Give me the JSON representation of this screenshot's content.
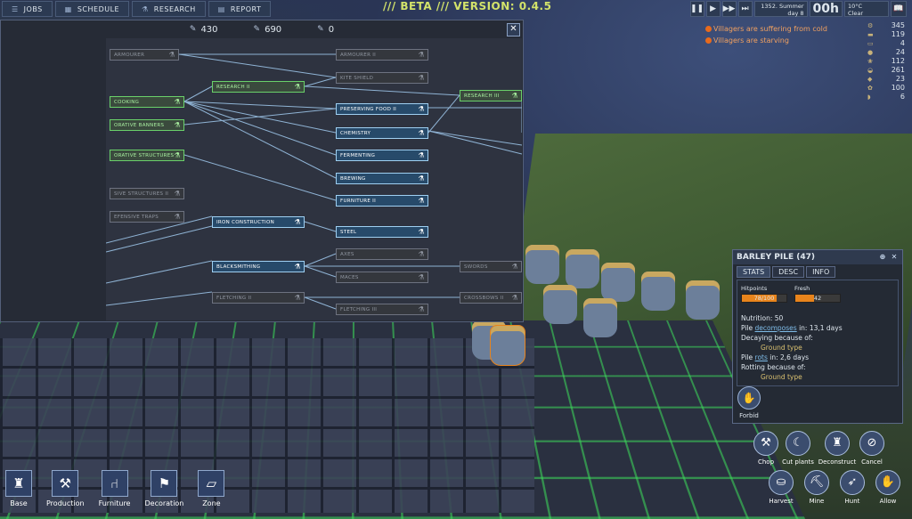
{
  "top_menu": [
    {
      "label": "JOBS",
      "icon": "list-icon"
    },
    {
      "label": "SCHEDULE",
      "icon": "calendar-icon"
    },
    {
      "label": "RESEARCH",
      "icon": "flask-icon"
    },
    {
      "label": "REPORT",
      "icon": "chart-icon"
    }
  ],
  "version_text": "/// BETA /// VERSION: 0.4.5",
  "time": {
    "date_line1": "1352. Summer",
    "date_line2": "day 8",
    "clock": "00h",
    "temperature": "10°C",
    "weather": "Clear"
  },
  "alerts": [
    "Villagers are suffering from cold",
    "Villagers are starving"
  ],
  "resources": [
    {
      "icon": "gear-icon",
      "value": "345"
    },
    {
      "icon": "log-icon",
      "value": "119"
    },
    {
      "icon": "plank-icon",
      "value": "4"
    },
    {
      "icon": "stone-icon",
      "value": "24"
    },
    {
      "icon": "grain-icon",
      "value": "112"
    },
    {
      "icon": "bag-icon",
      "value": "261"
    },
    {
      "icon": "ore-icon",
      "value": "23"
    },
    {
      "icon": "food-icon",
      "value": "100"
    },
    {
      "icon": "bread-icon",
      "value": "6"
    }
  ],
  "research": {
    "points": [
      {
        "icon": "scroll-icon",
        "value": "430"
      },
      {
        "icon": "book-icon",
        "value": "690"
      },
      {
        "icon": "tome-icon",
        "value": "0"
      }
    ],
    "nodes": [
      {
        "label": "ARMOURER",
        "state": "lock"
      },
      {
        "label": "ARMOURER II",
        "state": "lock"
      },
      {
        "label": "KITE SHIELD",
        "state": "lock"
      },
      {
        "label": "RESEARCH II",
        "state": "done"
      },
      {
        "label": "RESEARCH III",
        "state": "done"
      },
      {
        "label": "COOKING",
        "state": "done"
      },
      {
        "label": "PRESERVING FOOD II",
        "state": "open"
      },
      {
        "label": "ORATIVE BANNERS",
        "state": "done"
      },
      {
        "label": "CHEMISTRY",
        "state": "open"
      },
      {
        "label": "ORATIVE STRUCTURES",
        "state": "done"
      },
      {
        "label": "FERMENTING",
        "state": "open"
      },
      {
        "label": "BREWING",
        "state": "open"
      },
      {
        "label": "SIVE STRUCTURES II",
        "state": "lock"
      },
      {
        "label": "FURNITURE II",
        "state": "open"
      },
      {
        "label": "EFENSIVE TRAPS",
        "state": "lock"
      },
      {
        "label": "IRON CONSTRUCTION",
        "state": "open"
      },
      {
        "label": "STEEL",
        "state": "open"
      },
      {
        "label": "AXES",
        "state": "lock"
      },
      {
        "label": "BLACKSMITHING",
        "state": "open"
      },
      {
        "label": "SWORDS",
        "state": "lock"
      },
      {
        "label": "MACES",
        "state": "lock"
      },
      {
        "label": "FLETCHING II",
        "state": "lock"
      },
      {
        "label": "CROSSBOWS II",
        "state": "lock"
      },
      {
        "label": "FLETCHING III",
        "state": "lock"
      }
    ]
  },
  "info_panel": {
    "title": "BARLEY PILE (47)",
    "tabs": [
      "STATS",
      "DESC",
      "INFO"
    ],
    "hitpoints_label": "Hitpoints",
    "hitpoints_value": "78/100",
    "hitpoints_fraction": 0.78,
    "fresh_label": "Fresh",
    "fresh_value": "42",
    "fresh_fraction": 0.42,
    "nutrition": "Nutrition: 50",
    "pile_word": "Pile",
    "decomposes_word": "decomposes",
    "decomposes_in": "in: 13,1 days",
    "decaying_because": "Decaying because of:",
    "decay_reason": "Ground type",
    "rots_word": "rots",
    "rots_in": "in: 2,6 days",
    "rotting_because": "Rotting because of:",
    "rot_reason": "Ground type",
    "forbid_label": "Forbid"
  },
  "actions": [
    {
      "label": "Chop",
      "icon": "axe-icon",
      "glyph": "⚒"
    },
    {
      "label": "Cut plants",
      "icon": "sickle-icon",
      "glyph": "☾"
    },
    {
      "label": "Deconstruct",
      "icon": "deconstruct-icon",
      "glyph": "♜"
    },
    {
      "label": "Cancel",
      "icon": "cancel-icon",
      "glyph": "⊘"
    },
    {
      "label": "Harvest",
      "icon": "basket-icon",
      "glyph": "⛀"
    },
    {
      "label": "Mine",
      "icon": "pickaxe-icon",
      "glyph": "⛏"
    },
    {
      "label": "Hunt",
      "icon": "hunt-icon",
      "glyph": "➶"
    },
    {
      "label": "Allow",
      "icon": "hand-icon",
      "glyph": "✋"
    }
  ],
  "build_bar": [
    {
      "label": "Base",
      "icon": "tower-icon",
      "glyph": "♜"
    },
    {
      "label": "Production",
      "icon": "anvil-icon",
      "glyph": "⚒"
    },
    {
      "label": "Furniture",
      "icon": "chair-icon",
      "glyph": "⑁"
    },
    {
      "label": "Decoration",
      "icon": "banner-icon",
      "glyph": "⚑"
    },
    {
      "label": "Zone",
      "icon": "zone-icon",
      "glyph": "▱"
    }
  ]
}
